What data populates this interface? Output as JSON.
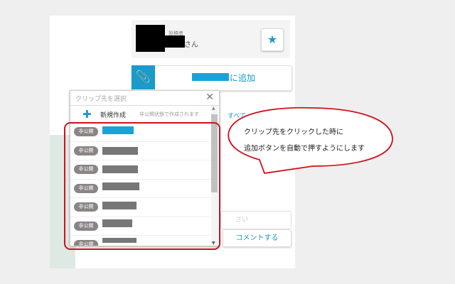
{
  "poster": {
    "label": "投稿者",
    "suffix": "さん"
  },
  "star_icon": "★",
  "add_button": {
    "label": "に追加"
  },
  "dropdown": {
    "placeholder": "クリップ先を選択",
    "close": "✕",
    "new": {
      "label": "新規作成",
      "hint": "非公開状態で作成されます"
    },
    "items": [
      {
        "badge": "非公開"
      },
      {
        "badge": "非公開"
      },
      {
        "badge": "非公開"
      },
      {
        "badge": "非公開"
      },
      {
        "badge": "非公開"
      },
      {
        "badge": "非公開"
      },
      {
        "badge": "非公開"
      }
    ]
  },
  "behind": {
    "all_link": "すべて",
    "input_placeholder": "さい",
    "comment_button": "コメントする"
  },
  "callout": {
    "line1": "クリップ先をクリックした時に",
    "line2": "追加ボタンを自動で押すようにします"
  },
  "colors": {
    "accent": "#1a9bc9",
    "annotation": "#d0101a"
  }
}
